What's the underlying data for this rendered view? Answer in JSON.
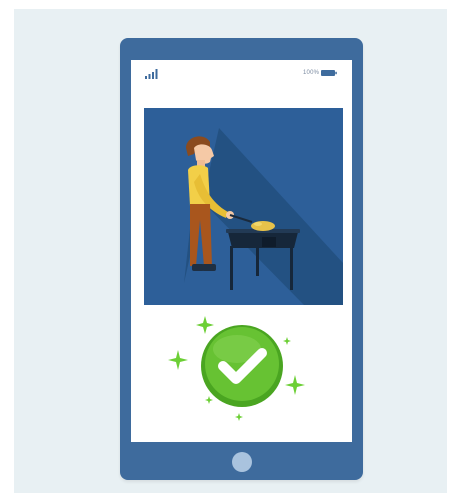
{
  "status_bar": {
    "signal_icon": "signal-bars-icon",
    "battery_percent": "100%",
    "battery_icon": "battery-icon"
  },
  "illustration": {
    "subject": "person-cooking-at-grill",
    "background_color": "#2d5f99"
  },
  "confirmation": {
    "icon": "checkmark-icon",
    "color": "#5cb82e"
  },
  "colors": {
    "phone_body": "#3e6b9d",
    "page_background": "#e8f0f3",
    "sparkle": "#6ccf35"
  }
}
